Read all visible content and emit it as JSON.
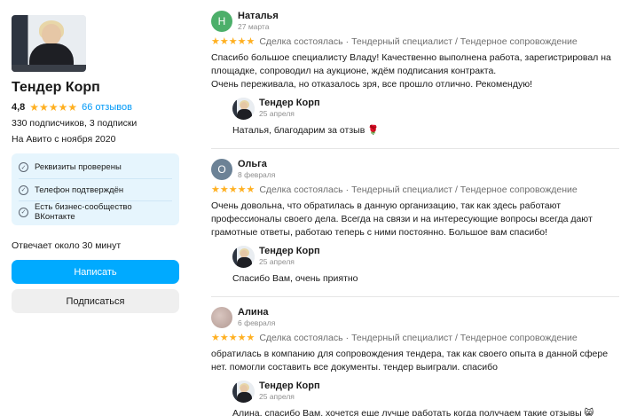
{
  "seller": {
    "name": "Тендер Корп",
    "rating": "4,8",
    "stars": "★★★★★",
    "reviews_link": "66 отзывов",
    "subscribers": "330 подписчиков, 3 подписки",
    "since": "На Авито с ноября 2020",
    "badges": [
      {
        "label": "Реквизиты проверены",
        "icon": "check-icon"
      },
      {
        "label": "Телефон подтверждён",
        "icon": "check-icon"
      },
      {
        "label": "Есть бизнес-сообщество ВКонтакте",
        "icon": "check-icon"
      }
    ],
    "response_time": "Отвечает около 30 минут",
    "write_button": "Написать",
    "subscribe_button": "Подписаться"
  },
  "reviews": [
    {
      "initial": "Н",
      "avatar_color": "#4caf6a",
      "name": "Наталья",
      "date": "27 марта",
      "stars": "★★★★★",
      "deal": "Сделка состоялась",
      "service": "Тендерный специалист / Тендерное сопровождение",
      "text": "Спасибо большое специалисту Владу! Качественно выполнена работа, зарегистрировал на площадке, сопроводил на аукционе, ждём подписания контракта.\nОчень переживала, но отказалось зря, все прошло отлично. Рекомендую!",
      "reply": {
        "name": "Тендер Корп",
        "date": "25 апреля",
        "text": "Наталья, благодарим за отзыв",
        "emoji": "🌹"
      }
    },
    {
      "initial": "О",
      "avatar_color": "#6c8296",
      "name": "Ольга",
      "date": "8 февраля",
      "stars": "★★★★★",
      "deal": "Сделка состоялась",
      "service": "Тендерный специалист / Тендерное сопровождение",
      "text": "Очень довольна, что обратилась в данную организацию, так как здесь работают профессионалы своего дела. Всегда на связи и на интересующие вопросы всегда дают грамотные ответы, работаю теперь с ними постоянно. Большое вам спасибо!",
      "reply": {
        "name": "Тендер Корп",
        "date": "25 апреля",
        "text": "Спасибо Вам, очень приятно",
        "emoji": ""
      }
    },
    {
      "initial": "",
      "avatar_color": "#c9b3ad",
      "name": "Алина",
      "date": "6 февраля",
      "stars": "★★★★★",
      "deal": "Сделка состоялась",
      "service": "Тендерный специалист / Тендерное сопровождение",
      "text": "обратилась в компанию для сопровождения тендера, так как своего опыта в данной сфере нет. помогли составить все документы. тендер выиграли. спасибо",
      "reply": {
        "name": "Тендер Корп",
        "date": "25 апреля",
        "text": "Алина, спасибо Вам, хочется еще лучше работать когда получаем такие отзывы",
        "emoji": "😸"
      }
    }
  ]
}
